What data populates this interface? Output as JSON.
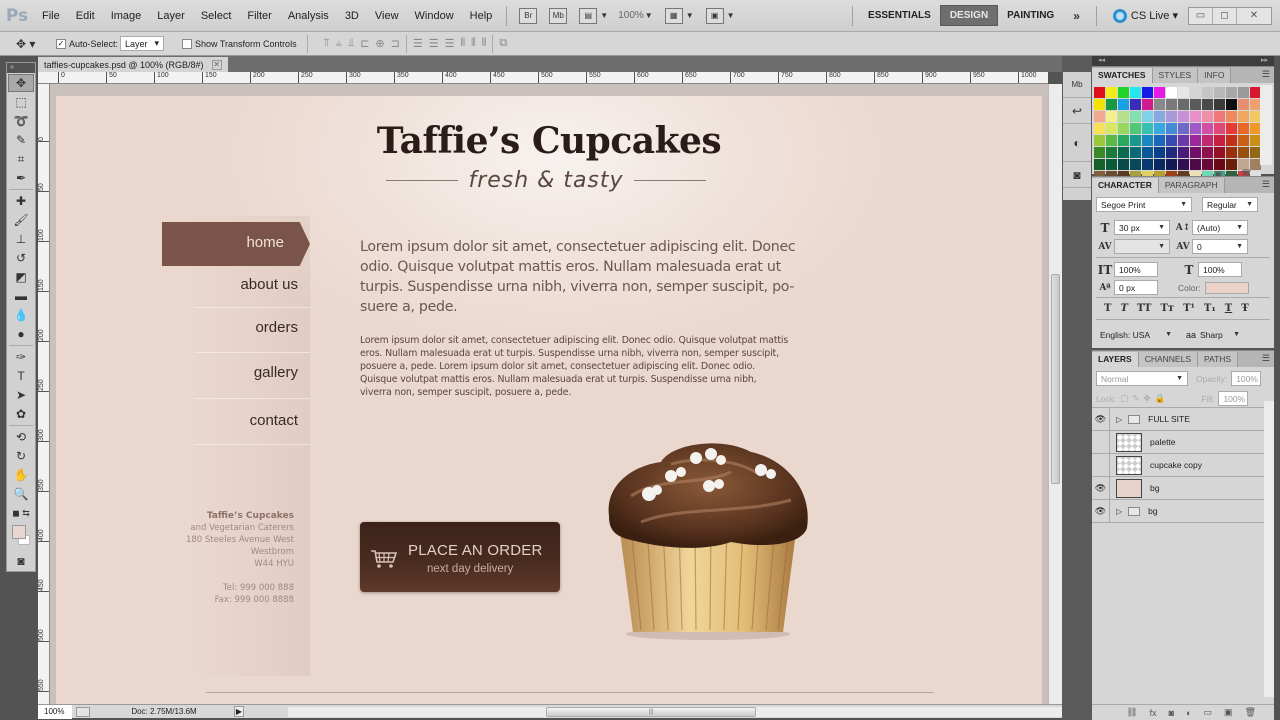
{
  "app": {
    "logo": "Ps",
    "menu": [
      "File",
      "Edit",
      "Image",
      "Layer",
      "Select",
      "Filter",
      "Analysis",
      "3D",
      "View",
      "Window",
      "Help"
    ],
    "bridge_label": "Br",
    "minibridge_label": "Mb",
    "zoom_level": "100%",
    "workspaces": [
      "ESSENTIALS",
      "DESIGN",
      "PAINTING"
    ],
    "active_workspace": "DESIGN",
    "more_workspaces": "»",
    "cs_live": "CS Live ▾",
    "window_controls": {
      "minimize": "▭",
      "restore": "◻",
      "close": "✕"
    }
  },
  "options_bar": {
    "tool_icon": "move-tool",
    "auto_select_label": "Auto-Select:",
    "auto_select_checked": true,
    "auto_select_value": "Layer",
    "show_transform_label": "Show Transform Controls",
    "show_transform_checked": false
  },
  "document": {
    "tab_title": "taffies-cupcakes.psd @ 100% (RGB/8#)",
    "close": "✕",
    "ruler_h_ticks": [
      "0",
      "50",
      "100",
      "150",
      "200",
      "250",
      "300",
      "350",
      "400",
      "450",
      "500",
      "550",
      "600",
      "650",
      "700",
      "750",
      "800",
      "850",
      "900",
      "950",
      "1000"
    ],
    "ruler_v_ticks": [
      "0",
      "50",
      "100",
      "150",
      "200",
      "250",
      "300",
      "350",
      "400",
      "450",
      "500",
      "550"
    ]
  },
  "site": {
    "title": "Taffie’s Cupcakes",
    "tagline": "fresh & tasty",
    "nav": [
      "home",
      "about us",
      "orders",
      "gallery",
      "contact"
    ],
    "active_nav": "home",
    "lead": "Lorem ipsum dolor sit amet, consectetuer adipiscing elit. Donec odio. Quisque volutpat mattis eros. Nullam malesuada erat ut turpis. Suspendisse urna nibh, viverra non, semper suscipit, po-suere a, pede.",
    "body": "Lorem ipsum dolor sit amet, consectetuer adipiscing elit. Donec odio. Quisque volutpat mattis eros. Nullam malesuada erat ut turpis. Suspendisse urna nibh, viverra non, semper suscipit, posuere a, pede. Lorem ipsum dolor sit amet, consectetuer adipiscing elit. Donec odio. Quisque volutpat mattis eros. Nullam malesuada erat ut turpis. Suspendisse urna nibh, viverra non, semper suscipit, posuere a, pede.",
    "address": {
      "name": "Taffie’s Cupcakes",
      "lines": [
        "and Vegetarian Caterers",
        "180 Steeles Avenue West",
        "Westbrom",
        "W44 HYU"
      ],
      "tel": "Tel: 999 000 888",
      "fax": "Fax: 999 000 8888"
    },
    "order_button": {
      "main": "PLACE AN ORDER",
      "sub": "next day delivery"
    },
    "colors": {
      "nav_active": "#7a5448",
      "button": "#4a2c20",
      "background": "#ead7ce"
    }
  },
  "status_bar": {
    "zoom": "100%",
    "doc_size": "Doc: 2.75M/13.6M"
  },
  "panels": {
    "swatches_tabs": [
      "SWATCHES",
      "STYLES",
      "INFO"
    ],
    "swatch_colors": [
      "#e0101a",
      "#f3ec18",
      "#22d12a",
      "#26e6f0",
      "#1a1ae6",
      "#e61ae6",
      "#ffffff",
      "#e6e6e6",
      "#d4d4d4",
      "#c6c6c6",
      "#b8b8b8",
      "#a8a8a8",
      "#9a9a9a",
      "#d81830",
      "#f6e400",
      "#189a44",
      "#1aa0e6",
      "#3a2cb8",
      "#d01a8e",
      "#8a8a8a",
      "#7a7a7a",
      "#6a6a6a",
      "#5a5a5a",
      "#4a4a4a",
      "#3a3a3a",
      "#101010",
      "#e69070",
      "#f0a070",
      "#f4a890",
      "#f4f090",
      "#b4e090",
      "#80e0b0",
      "#80d0e8",
      "#88a8e0",
      "#a898d8",
      "#c890d8",
      "#e890c8",
      "#f090a8",
      "#f07878",
      "#f08860",
      "#f0a860",
      "#f0c860",
      "#f8e058",
      "#d8e860",
      "#98d860",
      "#50c878",
      "#38c0b0",
      "#38a8e0",
      "#4888d8",
      "#7068c8",
      "#a058c8",
      "#d050a8",
      "#e04878",
      "#e83838",
      "#e86828",
      "#f09828",
      "#9ac83a",
      "#5ab848",
      "#2aa860",
      "#1a9890",
      "#1a88c0",
      "#1a68b8",
      "#3a4ab0",
      "#6a38a8",
      "#9a2898",
      "#c02870",
      "#c82040",
      "#c03018",
      "#c86018",
      "#c89018",
      "#3a8a2a",
      "#1a7a3a",
      "#0a6a50",
      "#0a6a78",
      "#0a5898",
      "#0a4088",
      "#202a80",
      "#481c78",
      "#701068",
      "#901050",
      "#981028",
      "#983010",
      "#985010",
      "#906818",
      "#18602a",
      "#0a5a3a",
      "#084a48",
      "#084858",
      "#083a70",
      "#082a60",
      "#141a58",
      "#301050",
      "#500848",
      "#680838",
      "#6a0818",
      "#6a2008",
      "#c0a890",
      "#a08060",
      "#806040",
      "#6a4a30",
      "#5a3a20",
      "#a8a040",
      "#e0d060",
      "#b8a030",
      "#a04018",
      "#604020",
      "#f0e0b8",
      "#70d8b0",
      "#40a888",
      "#306040",
      "#c84040",
      "#e0e0e0"
    ],
    "character_tabs": [
      "CHARACTER",
      "PARAGRAPH"
    ],
    "font_family": "Segoe Print",
    "font_style": "Regular",
    "font_size": "30 px",
    "leading": "(Auto)",
    "kerning": "",
    "tracking": "0",
    "vertical_scale": "100%",
    "horizontal_scale": "100%",
    "baseline_shift": "0 px",
    "color_label": "Color:",
    "text_color": "#ead3ca",
    "type_buttons": [
      "T",
      "T",
      "TT",
      "Tт",
      "T¹",
      "T₁",
      "T",
      "Ŧ"
    ],
    "language": "English: USA",
    "antialias_glyph": "aa",
    "antialias": "Sharp",
    "layers_tabs": [
      "LAYERS",
      "CHANNELS",
      "PATHS"
    ],
    "blend_mode": "Normal",
    "opacity_label": "Opacity:",
    "opacity": "100%",
    "lock_label": "Lock:",
    "fill_label": "Fill:",
    "fill": "100%",
    "layers": [
      {
        "name": "FULL SITE",
        "type": "group",
        "visible": true
      },
      {
        "name": "palette",
        "type": "smart",
        "visible": false
      },
      {
        "name": "cupcake copy",
        "type": "pixel",
        "visible": false
      },
      {
        "name": "bg",
        "type": "fill",
        "visible": true
      },
      {
        "name": "bg",
        "type": "group",
        "visible": true
      }
    ]
  }
}
